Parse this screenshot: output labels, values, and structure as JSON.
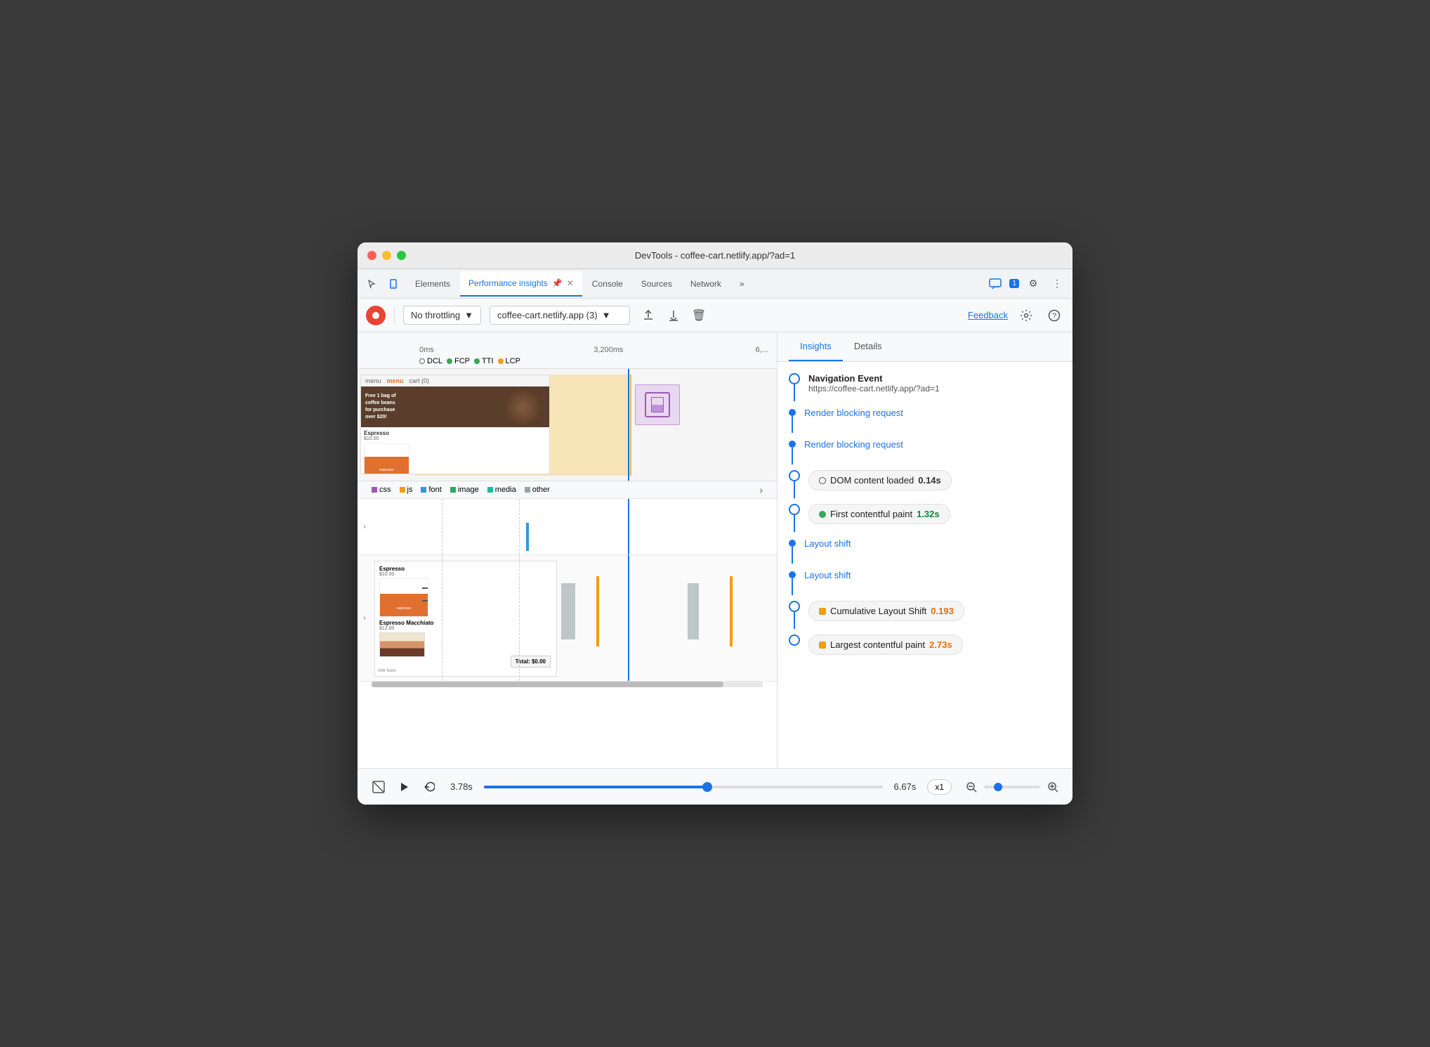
{
  "window": {
    "title": "DevTools - coffee-cart.netlify.app/?ad=1"
  },
  "tabs": {
    "items": [
      {
        "label": "Elements",
        "active": false
      },
      {
        "label": "Performance insights",
        "active": true
      },
      {
        "label": "Console",
        "active": false
      },
      {
        "label": "Sources",
        "active": false
      },
      {
        "label": "Network",
        "active": false
      }
    ],
    "more_label": "»",
    "badge": "1",
    "settings_icon": "⚙",
    "more_icon": "⋮"
  },
  "toolbar": {
    "record_label": "●",
    "throttling": {
      "label": "No throttling",
      "dropdown_icon": "▼"
    },
    "url": {
      "label": "coffee-cart.netlify.app (3)",
      "dropdown_icon": "▼"
    },
    "upload_icon": "↑",
    "download_icon": "↓",
    "delete_icon": "🗑",
    "feedback_label": "Feedback",
    "settings_icon": "⚙",
    "help_icon": "?"
  },
  "timeline": {
    "ruler": {
      "marks": [
        "0ms",
        "",
        "3,200ms",
        "",
        "6,"
      ]
    },
    "legend": {
      "dcl": "DCL",
      "fcp": "FCP",
      "tti": "TTI",
      "lcp": "LCP"
    },
    "network_legend": {
      "items": [
        {
          "color": "#9b59b6",
          "label": "css"
        },
        {
          "color": "#f39c12",
          "label": "js"
        },
        {
          "color": "#3498db",
          "label": "font"
        },
        {
          "color": "#27ae60",
          "label": "image"
        },
        {
          "color": "#1abc9c",
          "label": "media"
        },
        {
          "color": "#95a5a6",
          "label": "other"
        }
      ]
    }
  },
  "insights": {
    "tabs": [
      "Insights",
      "Details"
    ],
    "active_tab": "Insights",
    "entries": [
      {
        "type": "navigation",
        "title": "Navigation Event",
        "url": "https://coffee-cart.netlify.app/?ad=1"
      },
      {
        "type": "link",
        "label": "Render blocking request"
      },
      {
        "type": "link",
        "label": "Render blocking request"
      },
      {
        "type": "badge",
        "icon_type": "circle-outline",
        "label": "DOM content loaded",
        "value": "0.14s",
        "value_color": "normal"
      },
      {
        "type": "badge",
        "icon_type": "circle-green",
        "label": "First contentful paint",
        "value": "1.32s",
        "value_color": "green"
      },
      {
        "type": "link",
        "label": "Layout shift"
      },
      {
        "type": "link",
        "label": "Layout shift"
      },
      {
        "type": "badge",
        "icon_type": "square-orange",
        "label": "Cumulative Layout Shift",
        "value": "0.193",
        "value_color": "orange"
      },
      {
        "type": "badge",
        "icon_type": "square-orange",
        "label": "Largest contentful paint",
        "value": "2.73s",
        "value_color": "orange"
      }
    ]
  },
  "playback": {
    "current_time": "3.78s",
    "end_time": "6.67s",
    "progress_pct": 56,
    "speed": "x1",
    "no_preview_icon": "⊠"
  }
}
